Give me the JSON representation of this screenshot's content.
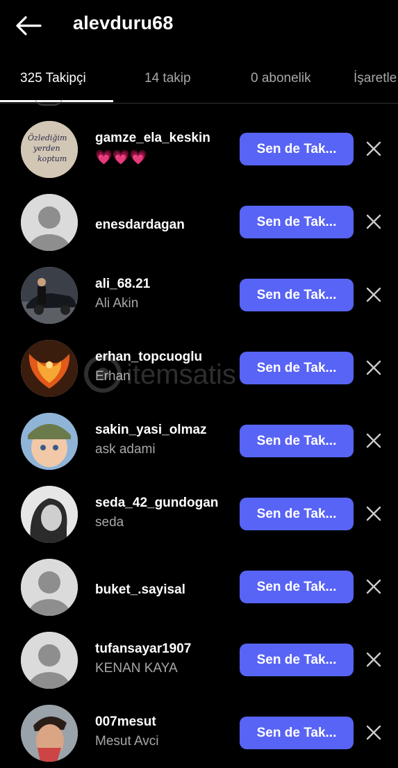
{
  "header": {
    "back_icon": "arrow-left-icon",
    "username": "alevduru68"
  },
  "tabs": [
    {
      "label": "325 Takipçi",
      "active": true
    },
    {
      "label": "14 takip",
      "active": false
    },
    {
      "label": "0 abonelik",
      "active": false
    },
    {
      "label": "İşaretle",
      "active": false
    }
  ],
  "followers": [
    {
      "username": "gamze_ela_keskin",
      "subtitle": "💗💗💗",
      "avatar": "text-photo",
      "avatar_text": [
        "Özlediğim",
        "yerden",
        "koptum"
      ],
      "button": "Sen de Tak...",
      "remove_icon": "close-icon"
    },
    {
      "username": "enesdardagan",
      "subtitle": "",
      "avatar": "default",
      "button": "Sen de Tak...",
      "remove_icon": "close-icon"
    },
    {
      "username": "ali_68.21",
      "subtitle": "Ali Akin",
      "avatar": "photo-car",
      "button": "Sen de Tak...",
      "remove_icon": "close-icon"
    },
    {
      "username": "erhan_topcuoglu",
      "subtitle": "Erhan",
      "avatar": "photo-phoenix",
      "button": "Sen de Tak...",
      "remove_icon": "close-icon"
    },
    {
      "username": "sakin_yasi_olmaz",
      "subtitle": "ask adami",
      "avatar": "photo-baby",
      "button": "Sen de Tak...",
      "remove_icon": "close-icon"
    },
    {
      "username": "seda_42_gundogan",
      "subtitle": "seda",
      "avatar": "photo-woman",
      "button": "Sen de Tak...",
      "remove_icon": "close-icon"
    },
    {
      "username": "buket_.sayisal",
      "subtitle": "",
      "avatar": "default",
      "button": "Sen de Tak...",
      "remove_icon": "close-icon"
    },
    {
      "username": "tufansayar1907",
      "subtitle": "KENAN KAYA",
      "avatar": "default",
      "button": "Sen de Tak...",
      "remove_icon": "close-icon"
    },
    {
      "username": "007mesut",
      "subtitle": "Mesut Avci",
      "avatar": "photo-man",
      "button": "Sen de Tak...",
      "remove_icon": "close-icon"
    }
  ],
  "watermark": {
    "text": "itemsatis"
  },
  "colors": {
    "background": "#000000",
    "button": "#5864f5",
    "secondary_text": "#a8a8a8",
    "divider": "#333333"
  }
}
